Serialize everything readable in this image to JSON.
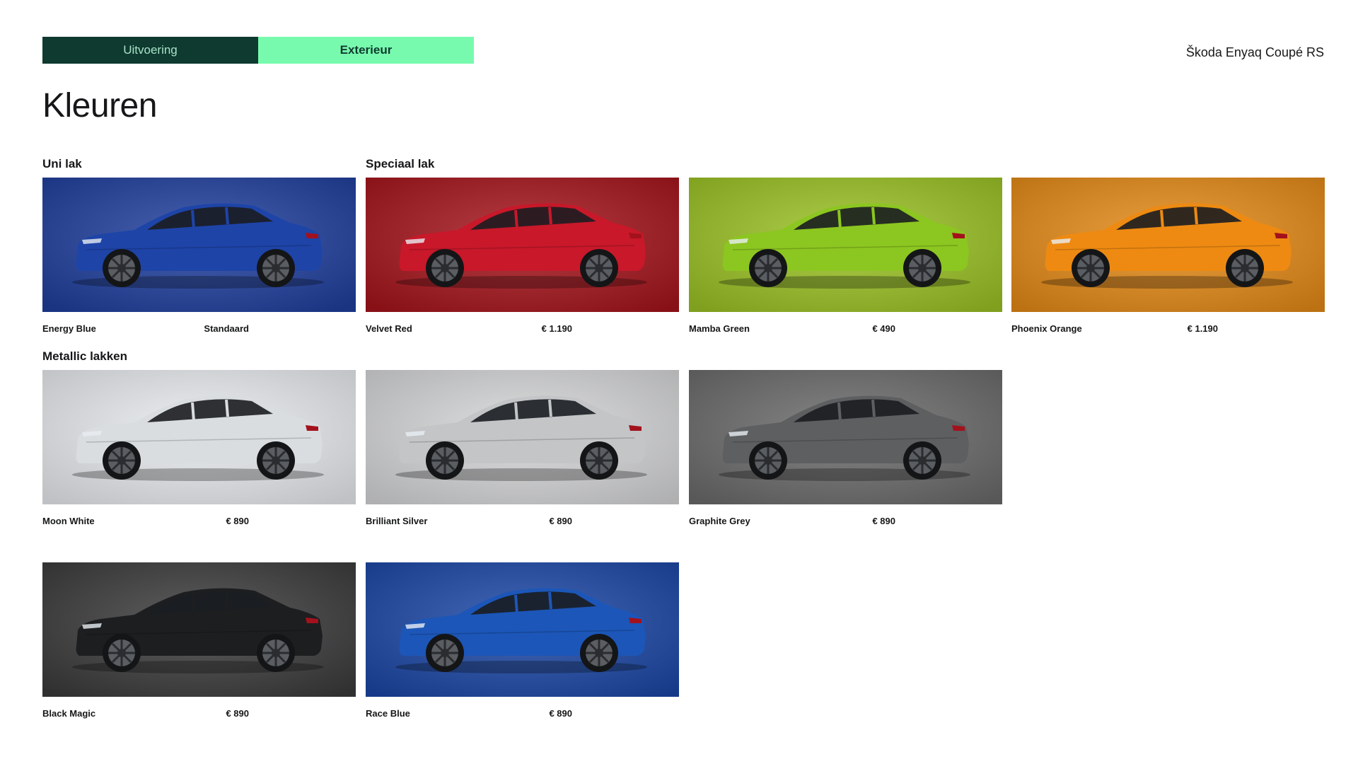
{
  "tabs": [
    {
      "label": "Uitvoering",
      "active": false
    },
    {
      "label": "Exterieur",
      "active": true
    }
  ],
  "model": "Škoda Enyaq Coupé RS",
  "title": "Kleuren",
  "sections": {
    "uni": "Uni lak",
    "special": "Speciaal lak",
    "metallic": "Metallic lakken"
  },
  "colors": [
    {
      "name": "Energy Blue",
      "price": "Standaard",
      "bg": "#1f3f9e",
      "car": "#1e44a8"
    },
    {
      "name": "Velvet Red",
      "price": "€ 1.190",
      "bg": "#a5141b",
      "car": "#c8182a"
    },
    {
      "name": "Mamba Green",
      "price": "€ 490",
      "bg": "#9bc224",
      "car": "#8cc620"
    },
    {
      "name": "Phoenix Orange",
      "price": "€ 1.190",
      "bg": "#e58a16",
      "car": "#ee8a12"
    },
    {
      "name": "Moon White",
      "price": "€ 890",
      "bg": "#e9ecef",
      "car": "#d9dde0"
    },
    {
      "name": "Brilliant Silver",
      "price": "€ 890",
      "bg": "#d6d7d8",
      "car": "#c3c5c7"
    },
    {
      "name": "Graphite Grey",
      "price": "€ 890",
      "bg": "#6b6b6b",
      "car": "#5d5f61"
    },
    {
      "name": "Black Magic",
      "price": "€ 890",
      "bg": "#3b3b3c",
      "car": "#1d1e20"
    },
    {
      "name": "Race Blue",
      "price": "€ 890",
      "bg": "#1b47a6",
      "car": "#1c56b8"
    }
  ]
}
